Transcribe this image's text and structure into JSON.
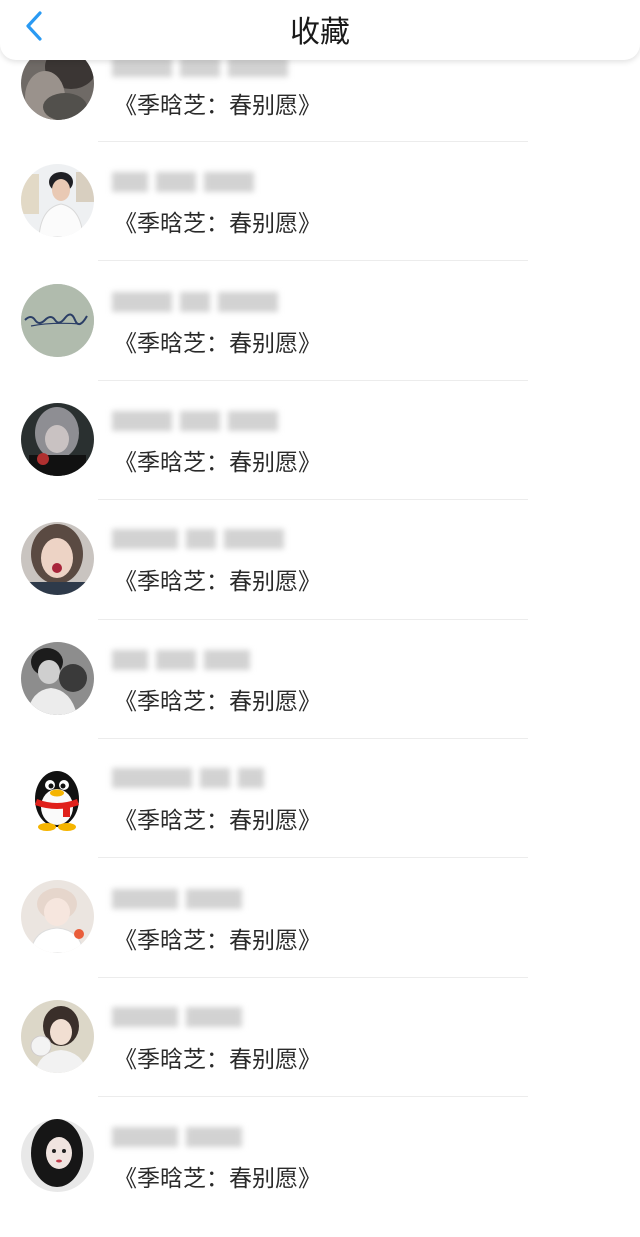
{
  "header": {
    "title": "收藏"
  },
  "items": [
    {
      "work": "《季晗芝：春别愿》",
      "avatar": "photo-avatar"
    },
    {
      "work": "《季晗芝：春别愿》",
      "avatar": "photo-avatar"
    },
    {
      "work": "《季晗芝：春别愿》",
      "avatar": "signature-avatar"
    },
    {
      "work": "《季晗芝：春别愿》",
      "avatar": "photo-avatar"
    },
    {
      "work": "《季晗芝：春别愿》",
      "avatar": "photo-avatar"
    },
    {
      "work": "《季晗芝：春别愿》",
      "avatar": "photo-avatar"
    },
    {
      "work": "《季晗芝：春别愿》",
      "avatar": "qq-penguin-avatar"
    },
    {
      "work": "《季晗芝：春别愿》",
      "avatar": "photo-avatar"
    },
    {
      "work": "《季晗芝：春别愿》",
      "avatar": "photo-avatar"
    },
    {
      "work": "《季晗芝：春别愿》",
      "avatar": "photo-avatar"
    }
  ],
  "colors": {
    "accent": "#2a9af3",
    "divider": "#ececec"
  }
}
